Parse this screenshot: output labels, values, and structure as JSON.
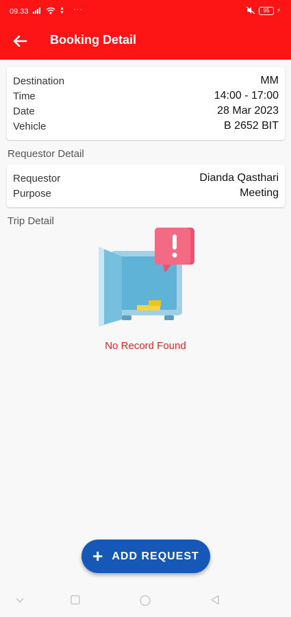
{
  "status": {
    "time": "09.33",
    "battery": "95"
  },
  "appbar": {
    "title": "Booking Detail",
    "back_icon": "arrow-left-icon"
  },
  "booking": [
    {
      "label": "Destination",
      "value": "MM"
    },
    {
      "label": "Time",
      "value": "14:00 - 17:00"
    },
    {
      "label": "Date",
      "value": "28 Mar 2023"
    },
    {
      "label": "Vehicle",
      "value": "B 2652 BIT"
    }
  ],
  "requestor_section": {
    "title": "Requestor Detail"
  },
  "requestor": [
    {
      "label": "Requestor",
      "value": "Dianda Qasthari"
    },
    {
      "label": "Purpose",
      "value": "Meeting"
    }
  ],
  "trip_section": {
    "title": "Trip Detail",
    "empty_message": "No Record Found"
  },
  "fab": {
    "label": "ADD REQUEST",
    "icon": "plus-icon"
  },
  "colors": {
    "primary": "#fd1414",
    "fab": "#1558b8",
    "empty_text": "#e82121"
  }
}
